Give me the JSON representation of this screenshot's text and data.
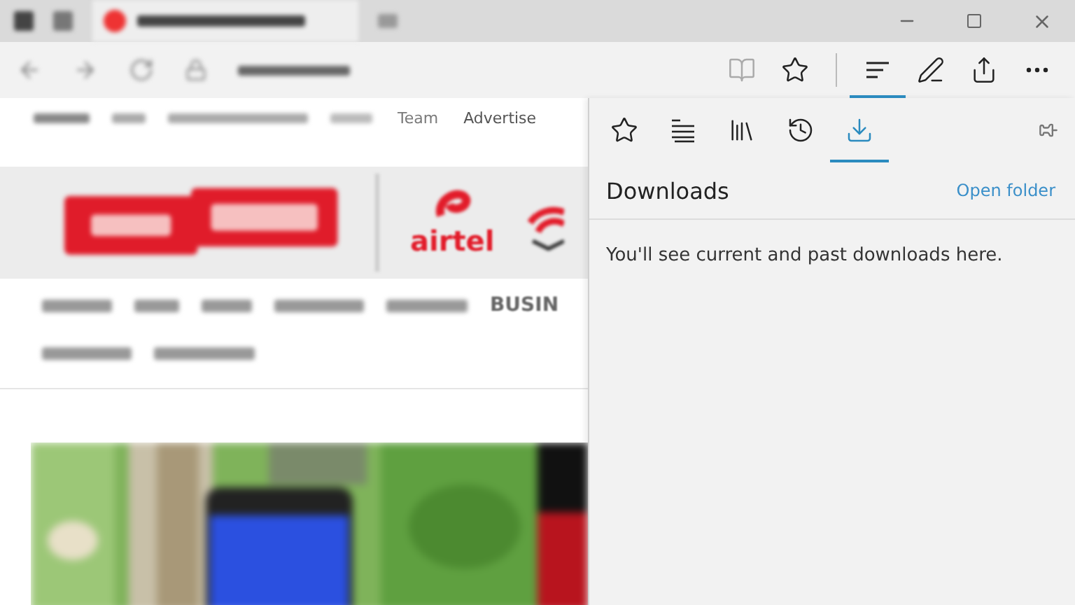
{
  "browser_toolbar": {
    "buttons": [
      {
        "kind": "reading-view",
        "disabled": true,
        "selected": false
      },
      {
        "kind": "favorite",
        "disabled": false,
        "selected": false
      },
      {
        "kind": "hub",
        "disabled": false,
        "selected": true
      },
      {
        "kind": "notes",
        "disabled": false,
        "selected": false
      },
      {
        "kind": "share",
        "disabled": false,
        "selected": false
      },
      {
        "kind": "more",
        "disabled": false,
        "selected": false
      }
    ]
  },
  "page": {
    "top_links": [
      "Team",
      "Advertise"
    ],
    "sponsor": "airtel",
    "nav": [
      "BUSIN"
    ]
  },
  "hub": {
    "tabs": [
      {
        "kind": "favorites",
        "selected": false
      },
      {
        "kind": "reading-list",
        "selected": false
      },
      {
        "kind": "books",
        "selected": false
      },
      {
        "kind": "history",
        "selected": false
      },
      {
        "kind": "downloads",
        "selected": true
      }
    ],
    "title": "Downloads",
    "action": "Open folder",
    "message": "You'll see current and past downloads here."
  }
}
